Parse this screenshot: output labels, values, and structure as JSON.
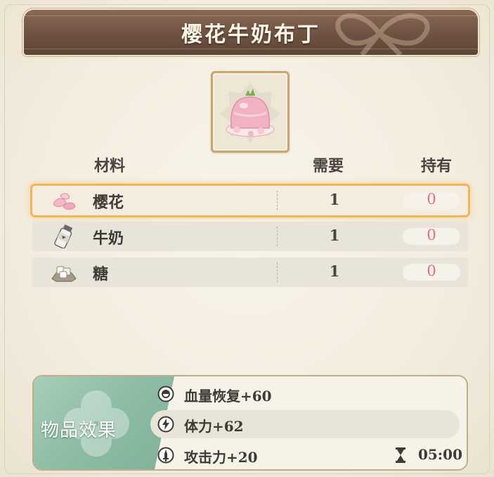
{
  "title": "樱花牛奶布丁",
  "item_icon": "cherry-blossom-pudding-icon",
  "headers": {
    "material": "材料",
    "need": "需要",
    "have": "持有"
  },
  "materials": [
    {
      "icon": "sakura-petals-icon",
      "name": "樱花",
      "need": "1",
      "have": "0",
      "selected": true
    },
    {
      "icon": "milk-bottle-icon",
      "name": "牛奶",
      "need": "1",
      "have": "0",
      "selected": false
    },
    {
      "icon": "sugar-cubes-icon",
      "name": "糖",
      "need": "1",
      "have": "0",
      "selected": false
    }
  ],
  "effects_label": "物品效果",
  "effects": [
    {
      "icon": "health-icon",
      "text": "血量恢复+60"
    },
    {
      "icon": "lightning-icon",
      "text": "体力+62"
    },
    {
      "icon": "attack-icon",
      "text": "攻击力+20",
      "duration": "05:00"
    }
  ],
  "colors": {
    "title_bg": "#6e5142",
    "highlight": "#f1b35b",
    "have_zero": "#e0707a",
    "effects_green": "#8dbca4"
  }
}
